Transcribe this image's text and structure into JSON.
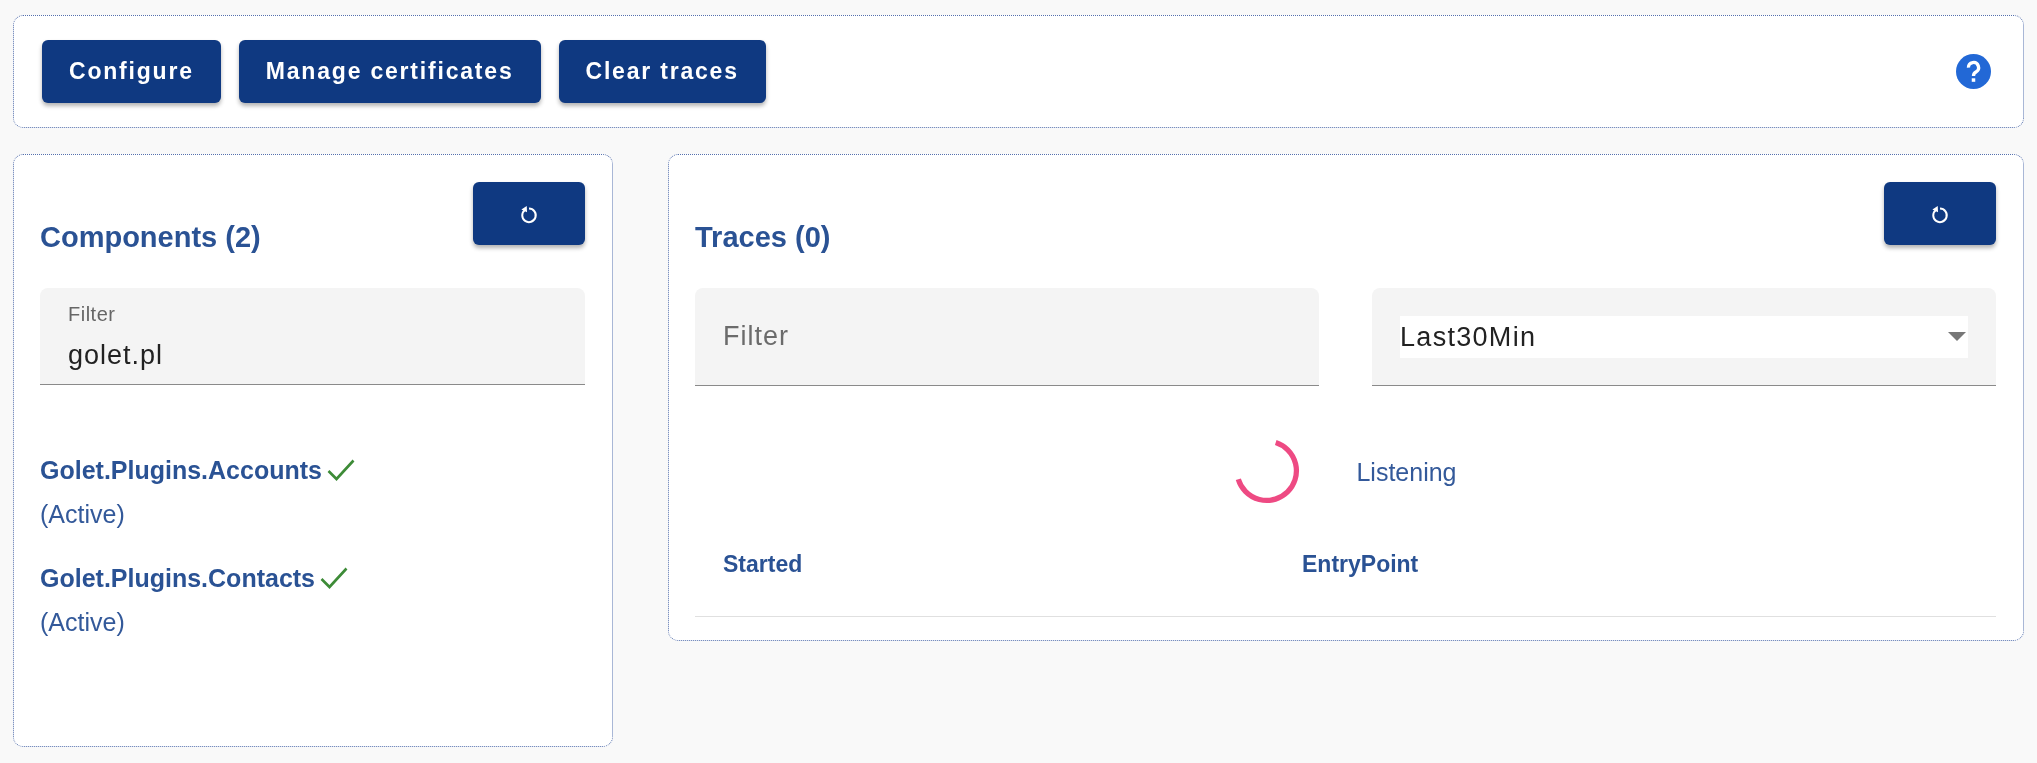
{
  "toolbar": {
    "buttons": [
      "Configure",
      "Manage certificates",
      "Clear traces"
    ]
  },
  "components": {
    "title": "Components (2)",
    "filter": {
      "label": "Filter",
      "value": "golet.pl"
    },
    "items": [
      {
        "name": "Golet.Plugins.Accounts",
        "active": true,
        "status": "(Active)"
      },
      {
        "name": "Golet.Plugins.Contacts",
        "active": true,
        "status": "(Active)"
      }
    ]
  },
  "traces": {
    "title": "Traces (0)",
    "filter": {
      "placeholder": "Filter"
    },
    "range": {
      "value": "Last30Min"
    },
    "listening": {
      "text": "Listening"
    },
    "table": {
      "columns": [
        "Started",
        "EntryPoint"
      ]
    }
  }
}
